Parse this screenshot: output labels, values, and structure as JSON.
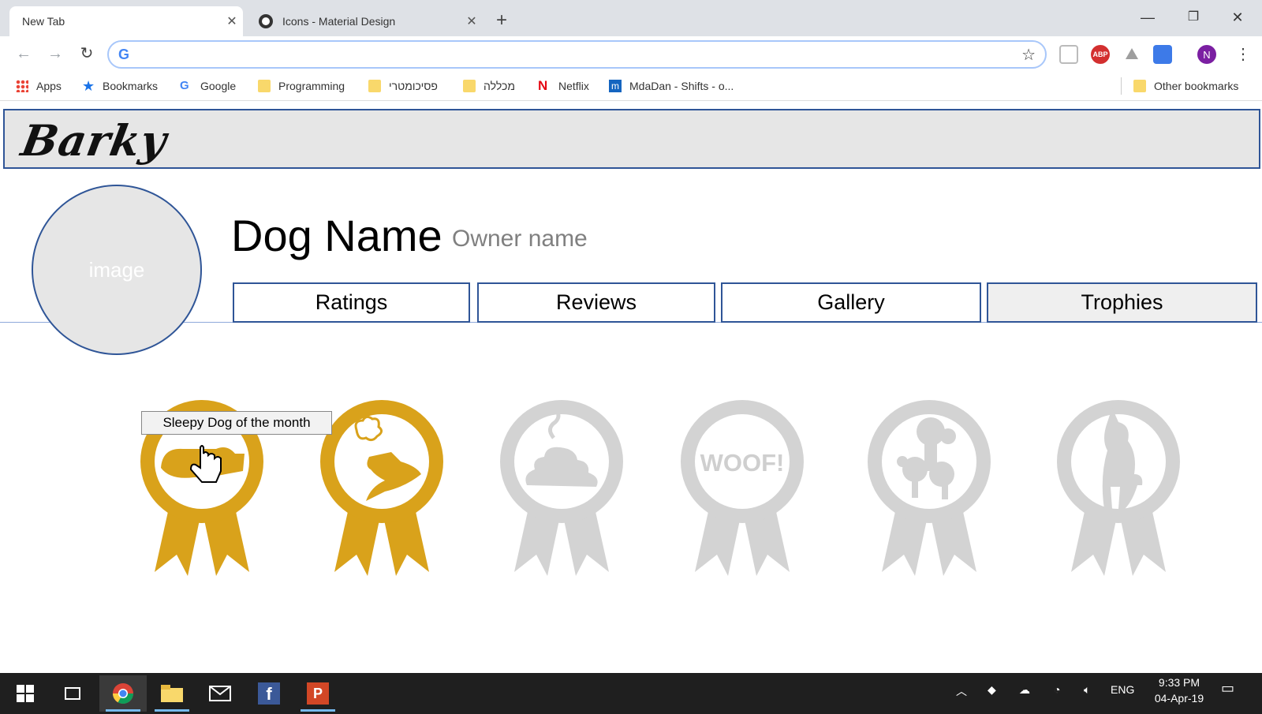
{
  "browser": {
    "tabs": [
      {
        "title": "New Tab",
        "active": true
      },
      {
        "title": "Icons - Material Design",
        "active": false
      }
    ],
    "omnibox": {
      "value": ""
    },
    "profile_initial": "N",
    "abp_label": "ABP",
    "bookmarks": [
      {
        "label": "Apps",
        "icon": "apps-grid-icon"
      },
      {
        "label": "Bookmarks",
        "icon": "star-icon"
      },
      {
        "label": "Google",
        "icon": "google-icon"
      },
      {
        "label": "Programming",
        "icon": "folder-icon"
      },
      {
        "label": "פסיכומטרי",
        "icon": "folder-icon"
      },
      {
        "label": "מכללה",
        "icon": "folder-icon"
      },
      {
        "label": "Netflix",
        "icon": "netflix-icon"
      },
      {
        "label": "MdaDan - Shifts - o...",
        "icon": "mdadan-icon"
      }
    ],
    "other_bookmarks": "Other bookmarks"
  },
  "page": {
    "logo": "Barky",
    "avatar_text": "image",
    "dog_name": "Dog Name",
    "owner_name": "Owner name",
    "tabs": [
      {
        "label": "Ratings"
      },
      {
        "label": "Reviews"
      },
      {
        "label": "Gallery"
      },
      {
        "label": "Trophies",
        "active": true
      }
    ],
    "trophies": [
      {
        "name": "sleeping-dog",
        "earned": true
      },
      {
        "name": "barking-dog",
        "earned": true
      },
      {
        "name": "poop",
        "earned": false
      },
      {
        "name": "woof",
        "earned": false,
        "text": "WOOF!"
      },
      {
        "name": "poodle",
        "earned": false
      },
      {
        "name": "sitting-dog",
        "earned": false
      }
    ],
    "tooltip": "Sleepy Dog of the month",
    "colors": {
      "gold": "#d9a21b",
      "grey": "#d3d3d3",
      "border": "#2f5597"
    }
  },
  "taskbar": {
    "tray_lang": "ENG",
    "time": "9:33 PM",
    "date": "04-Apr-19"
  }
}
